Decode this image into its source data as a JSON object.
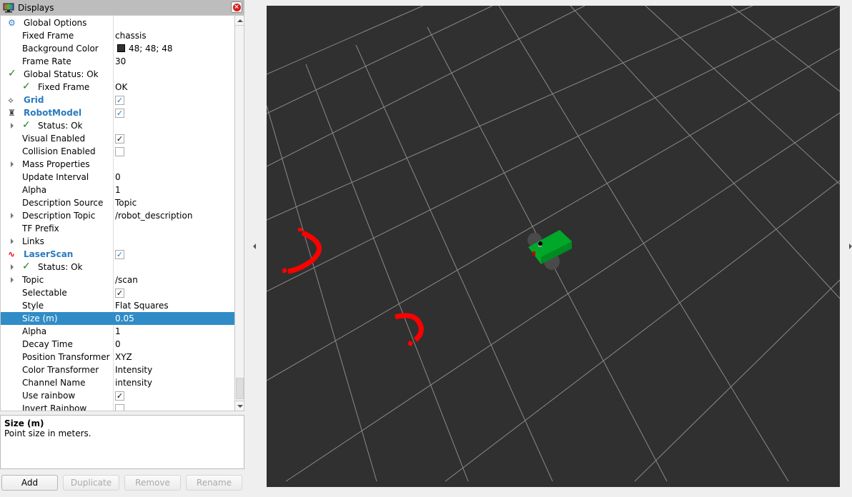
{
  "displays_panel": {
    "title": "Displays",
    "icons": {
      "title": "monitor-icon",
      "close": "close-icon"
    },
    "rows": [
      {
        "label": "Global Options",
        "value": "",
        "icon": "gear-icon",
        "kind": "top"
      },
      {
        "label": "Fixed Frame",
        "value": "chassis"
      },
      {
        "label": "Background Color",
        "value": "48; 48; 48",
        "swatch": "#303030"
      },
      {
        "label": "Frame Rate",
        "value": "30"
      },
      {
        "label": "Global Status: Ok",
        "value": "",
        "icon": "check-icon",
        "kind": "top"
      },
      {
        "label": "Fixed Frame",
        "value": "OK",
        "icon": "check-icon",
        "indent": true
      },
      {
        "label": "Grid",
        "value": "",
        "checked": true,
        "icon": "grid-icon",
        "kind": "display"
      },
      {
        "label": "RobotModel",
        "value": "",
        "checked": true,
        "icon": "robot-icon",
        "kind": "display"
      },
      {
        "label": "Status: Ok",
        "value": "",
        "icon": "check-icon",
        "expandable": true,
        "indent": true
      },
      {
        "label": "Visual Enabled",
        "checked": true
      },
      {
        "label": "Collision Enabled",
        "checked": false
      },
      {
        "label": "Mass Properties",
        "value": "",
        "expandable": true
      },
      {
        "label": "Update Interval",
        "value": "0"
      },
      {
        "label": "Alpha",
        "value": "1"
      },
      {
        "label": "Description Source",
        "value": "Topic"
      },
      {
        "label": "Description Topic",
        "value": "/robot_description",
        "expandable": true
      },
      {
        "label": "TF Prefix",
        "value": ""
      },
      {
        "label": "Links",
        "value": "",
        "expandable": true
      },
      {
        "label": "LaserScan",
        "value": "",
        "checked": true,
        "icon": "laserscan-icon",
        "kind": "display"
      },
      {
        "label": "Status: Ok",
        "value": "",
        "icon": "check-icon",
        "expandable": true,
        "indent": true
      },
      {
        "label": "Topic",
        "value": "/scan",
        "expandable": true
      },
      {
        "label": "Selectable",
        "checked": true
      },
      {
        "label": "Style",
        "value": "Flat Squares"
      },
      {
        "label": "Size (m)",
        "value": "0.05",
        "selected": true
      },
      {
        "label": "Alpha",
        "value": "1"
      },
      {
        "label": "Decay Time",
        "value": "0"
      },
      {
        "label": "Position Transformer",
        "value": "XYZ"
      },
      {
        "label": "Color Transformer",
        "value": "Intensity"
      },
      {
        "label": "Channel Name",
        "value": "intensity"
      },
      {
        "label": "Use rainbow",
        "checked": true
      },
      {
        "label": "Invert Rainbow",
        "checked": false
      }
    ]
  },
  "description": {
    "title": "Size (m)",
    "text": "Point size in meters."
  },
  "buttons": {
    "add": "Add",
    "duplicate": "Duplicate",
    "remove": "Remove",
    "rename": "Rename"
  },
  "viewport": {
    "background_color": "#303030",
    "grid_color": "#a0a0a0",
    "laser_color": "#ff0000",
    "robot_body_color": "#00a82a"
  },
  "colors": {
    "selection": "#308cc6",
    "display_label": "#2a7ac0",
    "status_ok": "#1e7d1e"
  }
}
